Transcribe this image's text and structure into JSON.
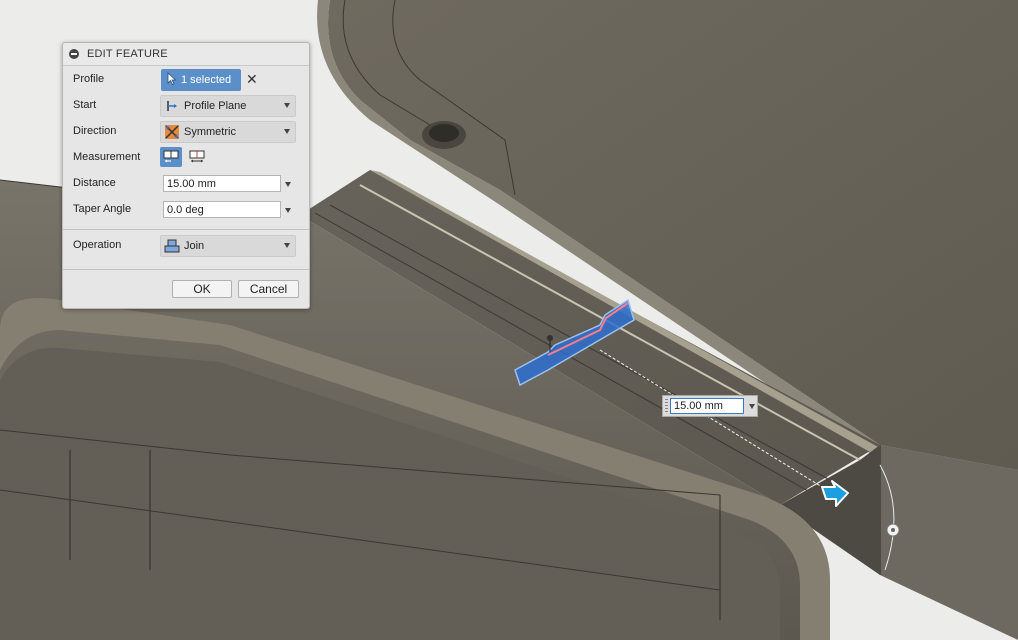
{
  "dialog": {
    "title": "EDIT FEATURE",
    "profile": {
      "label": "Profile",
      "value": "1 selected",
      "clear_glyph": "✕"
    },
    "start": {
      "label": "Start",
      "value": "Profile Plane",
      "icon": "profile-plane-icon"
    },
    "direction": {
      "label": "Direction",
      "value": "Symmetric",
      "icon": "symmetric-icon"
    },
    "measurement": {
      "label": "Measurement",
      "options": [
        "half-length-icon",
        "whole-length-icon"
      ],
      "selected": 0
    },
    "distance": {
      "label": "Distance",
      "value": "15.00 mm"
    },
    "taper": {
      "label": "Taper Angle",
      "value": "0.0 deg"
    },
    "operation": {
      "label": "Operation",
      "value": "Join",
      "icon": "join-icon"
    },
    "ok_label": "OK",
    "cancel_label": "Cancel"
  },
  "canvas": {
    "distance_input": "15.00 mm",
    "accent_color": "#2e6fd0",
    "manipulator_color": "#1b9fe0"
  }
}
